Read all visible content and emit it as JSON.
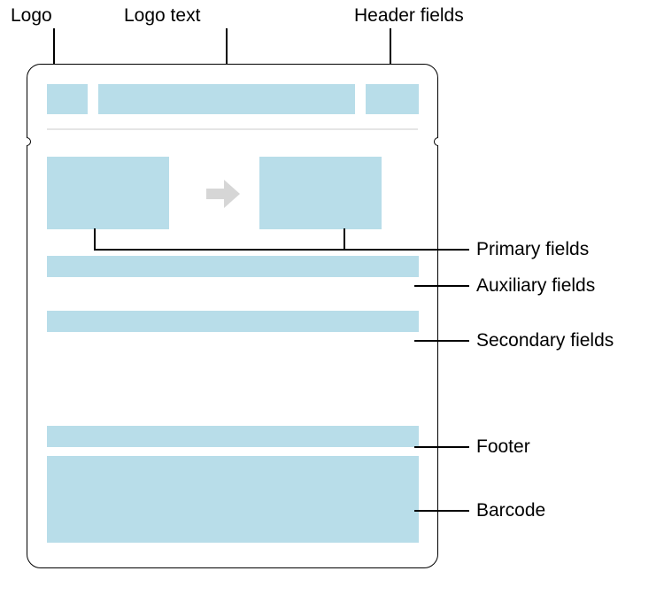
{
  "labels": {
    "logo": "Logo",
    "logo_text": "Logo text",
    "header_fields": "Header fields",
    "primary_fields": "Primary fields",
    "auxiliary_fields": "Auxiliary fields",
    "secondary_fields": "Secondary fields",
    "footer": "Footer",
    "barcode": "Barcode"
  },
  "icons": {
    "arrow": "arrow-right"
  },
  "colors": {
    "block": "#b8dde9",
    "arrow": "#d6d6d6"
  }
}
